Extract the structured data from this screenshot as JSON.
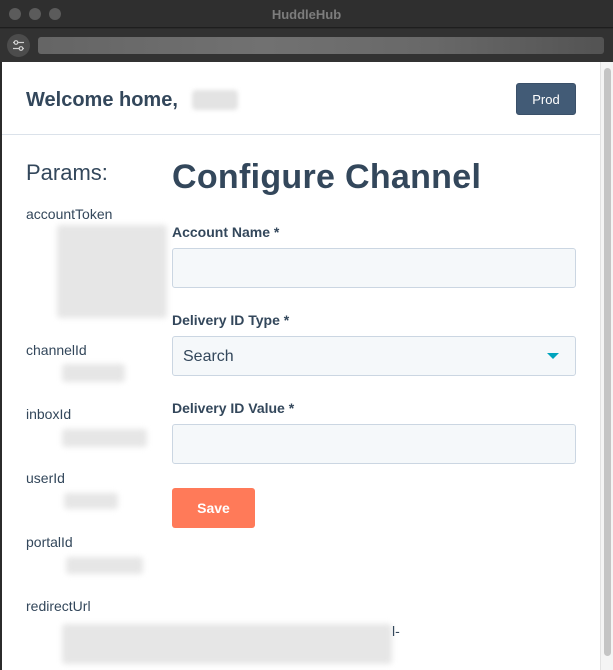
{
  "window": {
    "title": "HuddleHub"
  },
  "header": {
    "welcome": "Welcome home,",
    "env_button": "Prod"
  },
  "params": {
    "title": "Params:",
    "labels": [
      "accountToken",
      "channelId",
      "inboxId",
      "userId",
      "portalId",
      "redirectUrl"
    ],
    "redirect_suffix": "l-"
  },
  "form": {
    "title": "Configure Channel",
    "account_name_label": "Account Name *",
    "account_name_value": "",
    "delivery_type_label": "Delivery ID Type *",
    "delivery_type_value": "Search",
    "delivery_value_label": "Delivery ID Value *",
    "delivery_value_value": "",
    "save_label": "Save"
  },
  "colors": {
    "primary_text": "#33475b",
    "save_button": "#ff7a59",
    "prod_button": "#425b76",
    "dropdown_caret": "#00a4bd"
  }
}
